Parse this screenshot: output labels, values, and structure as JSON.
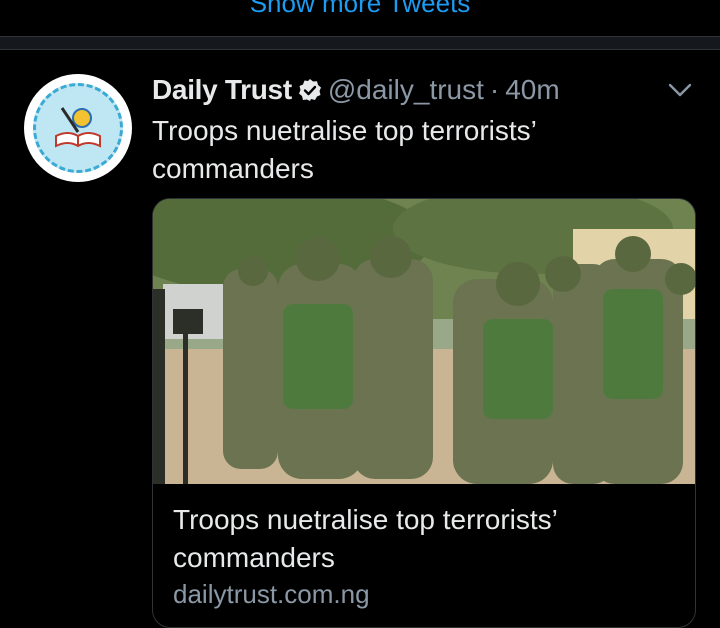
{
  "timeline": {
    "show_more_label": "Show more Tweets"
  },
  "tweet": {
    "display_name": "Daily Trust",
    "handle": "@daily_trust",
    "separator": "·",
    "time": "40m",
    "text": "Troops nuetralise top terrorists’ commanders",
    "card": {
      "title": "Troops nuetralise top terrorists’ commanders",
      "domain": "dailytrust.com.ng"
    }
  },
  "icons": {
    "verified": "verified-badge-icon",
    "menu": "chevron-down-icon",
    "avatar": "daily-trust-logo"
  },
  "colors": {
    "accent": "#1d9bf0",
    "background": "#000000",
    "secondary_text": "#8b98a5"
  }
}
